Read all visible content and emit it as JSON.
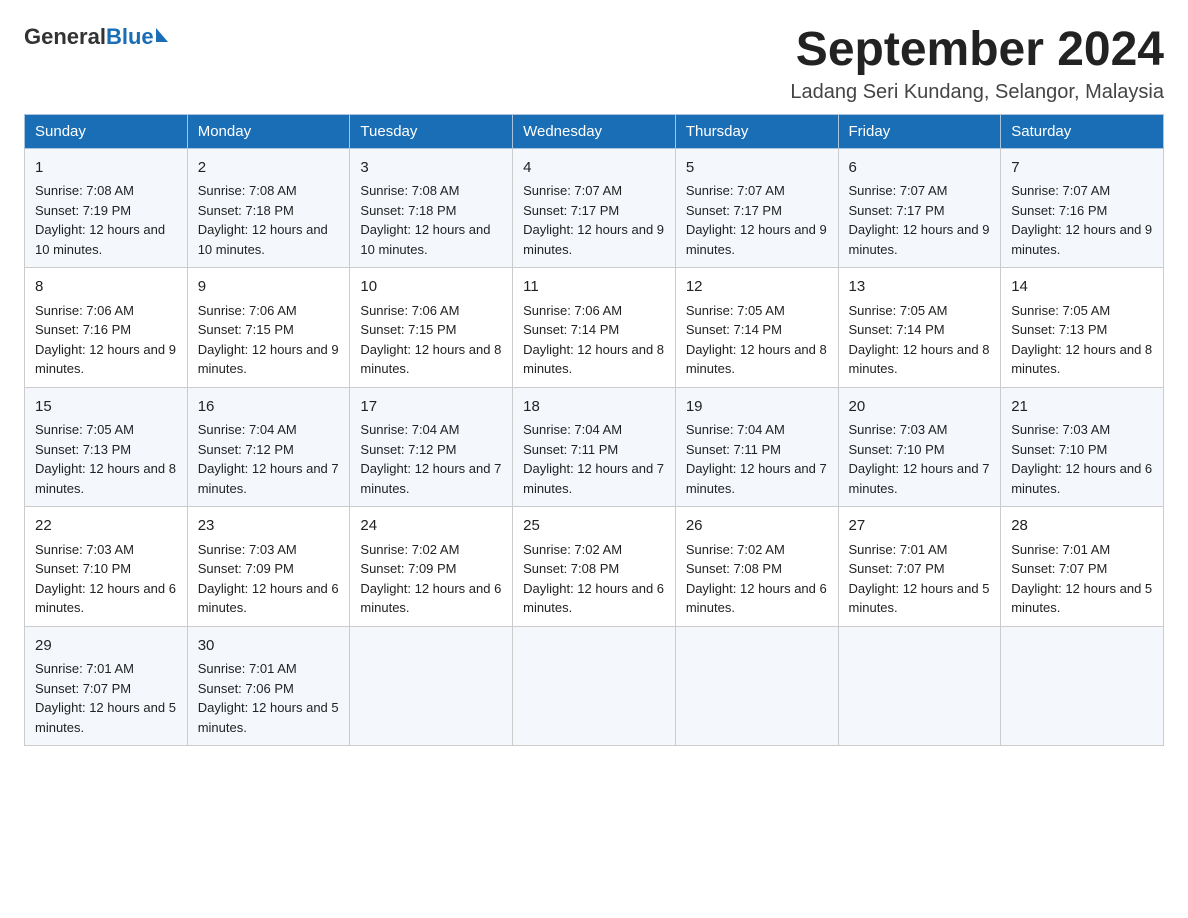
{
  "header": {
    "logo": {
      "general": "General",
      "blue": "Blue"
    },
    "title": "September 2024",
    "location": "Ladang Seri Kundang, Selangor, Malaysia"
  },
  "calendar": {
    "days": [
      "Sunday",
      "Monday",
      "Tuesday",
      "Wednesday",
      "Thursday",
      "Friday",
      "Saturday"
    ],
    "weeks": [
      [
        {
          "num": "1",
          "sunrise": "7:08 AM",
          "sunset": "7:19 PM",
          "daylight": "12 hours and 10 minutes."
        },
        {
          "num": "2",
          "sunrise": "7:08 AM",
          "sunset": "7:18 PM",
          "daylight": "12 hours and 10 minutes."
        },
        {
          "num": "3",
          "sunrise": "7:08 AM",
          "sunset": "7:18 PM",
          "daylight": "12 hours and 10 minutes."
        },
        {
          "num": "4",
          "sunrise": "7:07 AM",
          "sunset": "7:17 PM",
          "daylight": "12 hours and 9 minutes."
        },
        {
          "num": "5",
          "sunrise": "7:07 AM",
          "sunset": "7:17 PM",
          "daylight": "12 hours and 9 minutes."
        },
        {
          "num": "6",
          "sunrise": "7:07 AM",
          "sunset": "7:17 PM",
          "daylight": "12 hours and 9 minutes."
        },
        {
          "num": "7",
          "sunrise": "7:07 AM",
          "sunset": "7:16 PM",
          "daylight": "12 hours and 9 minutes."
        }
      ],
      [
        {
          "num": "8",
          "sunrise": "7:06 AM",
          "sunset": "7:16 PM",
          "daylight": "12 hours and 9 minutes."
        },
        {
          "num": "9",
          "sunrise": "7:06 AM",
          "sunset": "7:15 PM",
          "daylight": "12 hours and 9 minutes."
        },
        {
          "num": "10",
          "sunrise": "7:06 AM",
          "sunset": "7:15 PM",
          "daylight": "12 hours and 8 minutes."
        },
        {
          "num": "11",
          "sunrise": "7:06 AM",
          "sunset": "7:14 PM",
          "daylight": "12 hours and 8 minutes."
        },
        {
          "num": "12",
          "sunrise": "7:05 AM",
          "sunset": "7:14 PM",
          "daylight": "12 hours and 8 minutes."
        },
        {
          "num": "13",
          "sunrise": "7:05 AM",
          "sunset": "7:14 PM",
          "daylight": "12 hours and 8 minutes."
        },
        {
          "num": "14",
          "sunrise": "7:05 AM",
          "sunset": "7:13 PM",
          "daylight": "12 hours and 8 minutes."
        }
      ],
      [
        {
          "num": "15",
          "sunrise": "7:05 AM",
          "sunset": "7:13 PM",
          "daylight": "12 hours and 8 minutes."
        },
        {
          "num": "16",
          "sunrise": "7:04 AM",
          "sunset": "7:12 PM",
          "daylight": "12 hours and 7 minutes."
        },
        {
          "num": "17",
          "sunrise": "7:04 AM",
          "sunset": "7:12 PM",
          "daylight": "12 hours and 7 minutes."
        },
        {
          "num": "18",
          "sunrise": "7:04 AM",
          "sunset": "7:11 PM",
          "daylight": "12 hours and 7 minutes."
        },
        {
          "num": "19",
          "sunrise": "7:04 AM",
          "sunset": "7:11 PM",
          "daylight": "12 hours and 7 minutes."
        },
        {
          "num": "20",
          "sunrise": "7:03 AM",
          "sunset": "7:10 PM",
          "daylight": "12 hours and 7 minutes."
        },
        {
          "num": "21",
          "sunrise": "7:03 AM",
          "sunset": "7:10 PM",
          "daylight": "12 hours and 6 minutes."
        }
      ],
      [
        {
          "num": "22",
          "sunrise": "7:03 AM",
          "sunset": "7:10 PM",
          "daylight": "12 hours and 6 minutes."
        },
        {
          "num": "23",
          "sunrise": "7:03 AM",
          "sunset": "7:09 PM",
          "daylight": "12 hours and 6 minutes."
        },
        {
          "num": "24",
          "sunrise": "7:02 AM",
          "sunset": "7:09 PM",
          "daylight": "12 hours and 6 minutes."
        },
        {
          "num": "25",
          "sunrise": "7:02 AM",
          "sunset": "7:08 PM",
          "daylight": "12 hours and 6 minutes."
        },
        {
          "num": "26",
          "sunrise": "7:02 AM",
          "sunset": "7:08 PM",
          "daylight": "12 hours and 6 minutes."
        },
        {
          "num": "27",
          "sunrise": "7:01 AM",
          "sunset": "7:07 PM",
          "daylight": "12 hours and 5 minutes."
        },
        {
          "num": "28",
          "sunrise": "7:01 AM",
          "sunset": "7:07 PM",
          "daylight": "12 hours and 5 minutes."
        }
      ],
      [
        {
          "num": "29",
          "sunrise": "7:01 AM",
          "sunset": "7:07 PM",
          "daylight": "12 hours and 5 minutes."
        },
        {
          "num": "30",
          "sunrise": "7:01 AM",
          "sunset": "7:06 PM",
          "daylight": "12 hours and 5 minutes."
        },
        null,
        null,
        null,
        null,
        null
      ]
    ]
  }
}
